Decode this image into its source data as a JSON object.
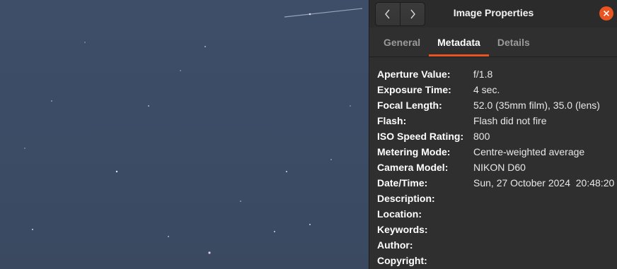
{
  "window": {
    "title": "Image Properties",
    "nav_back_icon": "chevron-left-icon",
    "nav_forward_icon": "chevron-right-icon",
    "close_icon": "close-icon",
    "accent_color": "#e95420"
  },
  "tabs": [
    {
      "label": "General",
      "active": false
    },
    {
      "label": "Metadata",
      "active": true
    },
    {
      "label": "Details",
      "active": false
    }
  ],
  "metadata": [
    {
      "label": "Aperture Value:",
      "value": "f/1.8"
    },
    {
      "label": "Exposure Time:",
      "value": "4 sec."
    },
    {
      "label": "Focal Length:",
      "value": "52.0 (35mm film), 35.0 (lens)"
    },
    {
      "label": "Flash:",
      "value": "Flash did not fire"
    },
    {
      "label": "ISO Speed Rating:",
      "value": "800"
    },
    {
      "label": "Metering Mode:",
      "value": "Centre-weighted average"
    },
    {
      "label": "Camera Model:",
      "value": "NIKON D60"
    },
    {
      "label": "Date/Time:",
      "value": "Sun, 27 October 2024  20:48:20"
    },
    {
      "label": "Description:",
      "value": ""
    },
    {
      "label": "Location:",
      "value": ""
    },
    {
      "label": "Keywords:",
      "value": ""
    },
    {
      "label": "Author:",
      "value": ""
    },
    {
      "label": "Copyright:",
      "value": ""
    }
  ]
}
